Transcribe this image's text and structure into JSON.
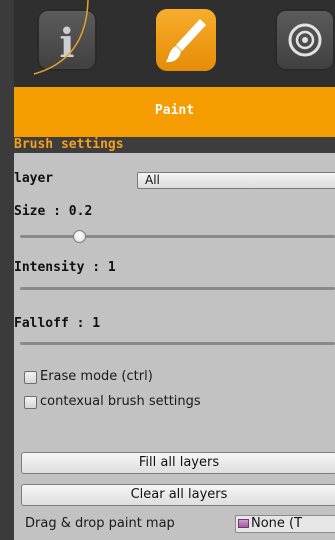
{
  "toolbar": {
    "tools": [
      {
        "name": "info",
        "glyph": "i",
        "icon": "info-icon"
      },
      {
        "name": "paint",
        "icon": "paint-brush-icon",
        "active": true
      },
      {
        "name": "target",
        "icon": "target-icon"
      }
    ]
  },
  "title": "Paint",
  "section_title": "Brush settings",
  "layer": {
    "label": "layer",
    "value": "All"
  },
  "size": {
    "label": "Size : 0.2",
    "value": 0.2
  },
  "intensity": {
    "label": "Intensity : 1",
    "value": 1
  },
  "falloff": {
    "label": "Falloff : 1",
    "value": 1
  },
  "checkboxes": {
    "erase_mode": {
      "label": "Erase mode (ctrl)",
      "checked": false
    },
    "contextual": {
      "label": "contexual brush settings",
      "checked": false
    }
  },
  "buttons": {
    "fill_all": "Fill all layers",
    "clear_all": "Clear all layers"
  },
  "paint_map": {
    "label": "Drag & drop paint map",
    "value": "None (T"
  },
  "colors": {
    "accent": "#f59c00",
    "section_text": "#f4a11b",
    "panel": "#c2c2c2"
  }
}
